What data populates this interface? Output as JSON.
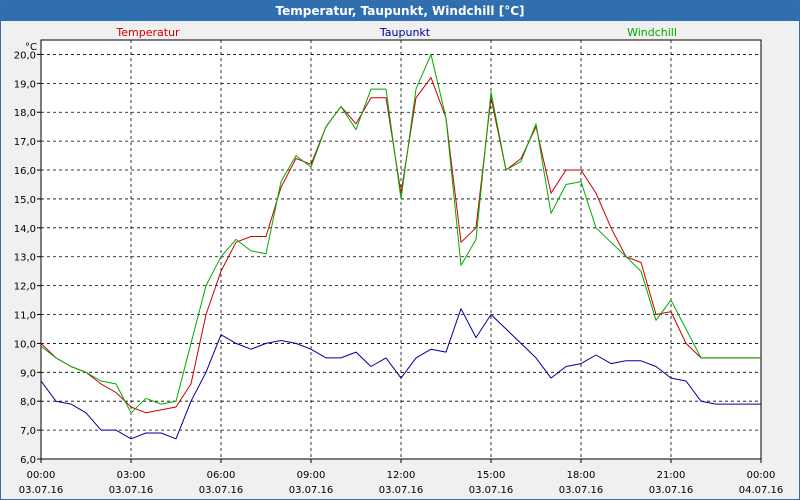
{
  "window": {
    "title": "Temperatur, Taupunkt, Windchill [°C]"
  },
  "chart_data": {
    "type": "line",
    "title": "Temperatur, Taupunkt, Windchill [°C]",
    "yunit": "°C",
    "ylim": [
      6.0,
      20.5
    ],
    "xlim": [
      "03.07.16 00:00",
      "04.07.16 00:00"
    ],
    "y_ticks": [
      "6,0",
      "7,0",
      "8,0",
      "9,0",
      "10,0",
      "11,0",
      "12,0",
      "13,0",
      "14,0",
      "15,0",
      "16,0",
      "17,0",
      "18,0",
      "19,0",
      "20,0"
    ],
    "x_ticks": [
      {
        "time": "00:00",
        "date": "03.07.16"
      },
      {
        "time": "03:00",
        "date": "03.07.16"
      },
      {
        "time": "06:00",
        "date": "03.07.16"
      },
      {
        "time": "09:00",
        "date": "03.07.16"
      },
      {
        "time": "12:00",
        "date": "03.07.16"
      },
      {
        "time": "15:00",
        "date": "03.07.16"
      },
      {
        "time": "18:00",
        "date": "03.07.16"
      },
      {
        "time": "21:00",
        "date": "03.07.16"
      },
      {
        "time": "00:00",
        "date": "04.07.16"
      }
    ],
    "grid": true,
    "legend_position": "top",
    "x_hours": [
      0,
      0.5,
      1,
      1.5,
      2,
      2.5,
      3,
      3.5,
      4,
      4.5,
      5,
      5.5,
      6,
      6.5,
      7,
      7.5,
      8,
      8.5,
      9,
      9.5,
      10,
      10.5,
      11,
      11.5,
      12,
      12.5,
      13,
      13.5,
      14,
      14.5,
      15,
      15.5,
      16,
      16.5,
      17,
      17.5,
      18,
      18.5,
      19,
      19.5,
      20,
      20.5,
      21,
      21.5,
      22,
      22.5,
      23,
      23.5,
      24
    ],
    "series": [
      {
        "name": "Temperatur",
        "color": "#cc0000",
        "values": [
          10.0,
          9.5,
          9.2,
          9.0,
          8.6,
          8.3,
          7.8,
          7.6,
          7.7,
          7.8,
          8.6,
          11.0,
          12.5,
          13.5,
          13.7,
          13.7,
          15.4,
          16.4,
          16.2,
          17.5,
          18.2,
          17.6,
          18.5,
          18.5,
          15.2,
          18.5,
          19.2,
          17.8,
          13.5,
          14.0,
          18.5,
          16.0,
          16.4,
          17.5,
          15.2,
          16.0,
          16.0,
          15.2,
          14.0,
          13.0,
          12.8,
          11.0,
          11.1,
          10.0,
          9.5,
          9.5,
          9.5,
          9.5,
          9.5
        ]
      },
      {
        "name": "Taupunkt",
        "color": "#000099",
        "values": [
          8.7,
          8.0,
          7.9,
          7.6,
          7.0,
          7.0,
          6.7,
          6.9,
          6.9,
          6.7,
          8.0,
          9.0,
          10.3,
          10.0,
          9.8,
          10.0,
          10.1,
          10.0,
          9.8,
          9.5,
          9.5,
          9.7,
          9.2,
          9.5,
          8.8,
          9.5,
          9.8,
          9.7,
          11.2,
          10.2,
          11.0,
          10.5,
          10.0,
          9.5,
          8.8,
          9.2,
          9.3,
          9.6,
          9.3,
          9.4,
          9.4,
          9.2,
          8.8,
          8.7,
          8.0,
          7.9,
          7.9,
          7.9,
          7.9
        ]
      },
      {
        "name": "Windchill",
        "color": "#00aa00",
        "values": [
          9.9,
          9.5,
          9.2,
          9.0,
          8.7,
          8.6,
          7.6,
          8.1,
          7.9,
          8.0,
          10.0,
          12.0,
          13.0,
          13.6,
          13.2,
          13.1,
          15.6,
          16.5,
          16.1,
          17.5,
          18.2,
          17.4,
          18.8,
          18.8,
          15.0,
          18.8,
          20.0,
          17.8,
          12.7,
          13.6,
          18.7,
          16.0,
          16.3,
          17.6,
          14.5,
          15.5,
          15.6,
          14.0,
          13.5,
          13.0,
          12.5,
          10.8,
          11.5,
          10.5,
          9.5,
          9.5,
          9.5,
          9.5,
          9.5
        ]
      }
    ]
  }
}
